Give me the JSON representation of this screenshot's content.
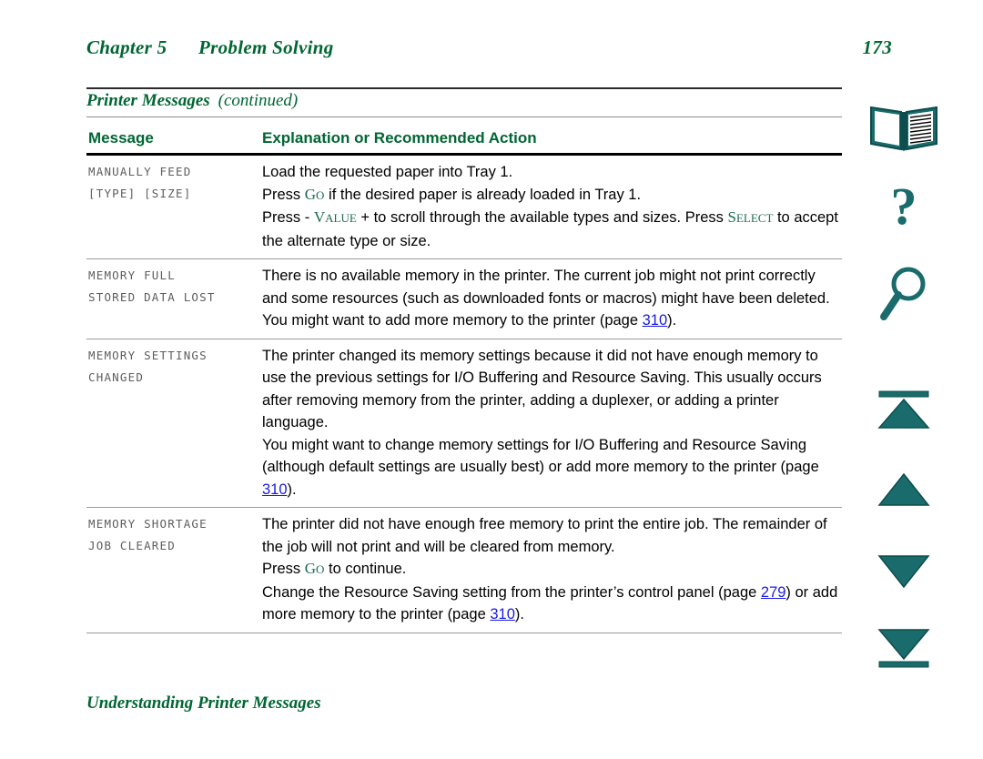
{
  "header": {
    "chapter_label": "Chapter 5",
    "chapter_title": "Problem Solving",
    "page_number": "173"
  },
  "table": {
    "caption_main": "Printer Messages",
    "caption_sub": "(continued)",
    "columns": {
      "message": "Message",
      "action": "Explanation or Recommended Action"
    },
    "rows": [
      {
        "message_lines": [
          "MANUALLY FEED",
          "[TYPE] [SIZE]"
        ],
        "action_lines": [
          "Load the requested paper into Tray 1.",
          "Press Go if the desired paper is already loaded in Tray 1.",
          "Press - VALUE + to scroll through the available types and sizes. Press SELECT to accept the alternate type or size."
        ]
      },
      {
        "message_lines": [
          "MEMORY FULL",
          "STORED DATA LOST"
        ],
        "action_lines": [
          "There is no available memory in the printer. The current job might not print correctly and some resources (such as downloaded fonts or macros) might have been deleted.",
          "You might want to add more memory to the printer (page 310)."
        ]
      },
      {
        "message_lines": [
          "MEMORY SETTINGS",
          "CHANGED"
        ],
        "action_lines": [
          "The printer changed its memory settings because it did not have enough memory to use the previous settings for I/O Buffering and Resource Saving. This usually occurs after removing memory from the printer, adding a duplexer, or adding a printer language.",
          "You might want to change memory settings for I/O Buffering and Resource Saving (although default settings are usually best) or add more memory to the printer (page 310)."
        ]
      },
      {
        "message_lines": [
          "MEMORY SHORTAGE",
          "JOB CLEARED"
        ],
        "action_lines": [
          "The printer did not have enough free memory to print the entire job. The remainder of the job will not print and will be cleared from memory.",
          "Press Go to continue.",
          "Change the Resource Saving setting from the printer's control panel (page 279) or add more memory to the printer (page 310)."
        ]
      }
    ]
  },
  "control_panel_keys": [
    "Go",
    "VALUE",
    "SELECT"
  ],
  "page_links": [
    "310",
    "279"
  ],
  "footer": {
    "title": "Understanding Printer Messages"
  },
  "nav_rail": {
    "items": [
      {
        "name": "book-icon",
        "label": "Contents"
      },
      {
        "name": "question-mark-icon",
        "label": "Help"
      },
      {
        "name": "magnifier-icon",
        "label": "Search"
      },
      {
        "name": "triangle-up-bar-icon",
        "label": "First Page"
      },
      {
        "name": "triangle-up-icon",
        "label": "Previous Page"
      },
      {
        "name": "triangle-down-icon",
        "label": "Next Page"
      },
      {
        "name": "triangle-down-bar-icon",
        "label": "Last Page"
      }
    ]
  },
  "colors": {
    "heading_green": "#006633",
    "icon_teal": "#1a6b6b",
    "link_blue": "#1a1ae6",
    "lcd_gray": "#5e5e5e",
    "rule_black": "#000000",
    "rule_gray": "#9a9a9a"
  }
}
